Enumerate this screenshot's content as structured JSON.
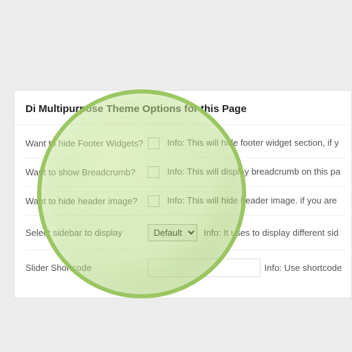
{
  "title": "Di Multipurpose Theme Options for this Page",
  "rows": {
    "r0": {
      "label": "Want to hide Footer Widgets?",
      "info": "Info: This will hide footer widget section, if y"
    },
    "r1": {
      "label": "Want to show Breadcrumb?",
      "info": "Info: This will display breadcrumb on this pa"
    },
    "r2": {
      "label": "Want to hide header image?",
      "info": "Info: This will hide header image. if you are"
    },
    "r3": {
      "label": "Select sidebar to display",
      "select": "Default",
      "info": "Info: It uses to display different sid"
    },
    "r4": {
      "label": "Slider Shortcode",
      "placeholder": "",
      "info": "Info: Use shortcode"
    }
  }
}
